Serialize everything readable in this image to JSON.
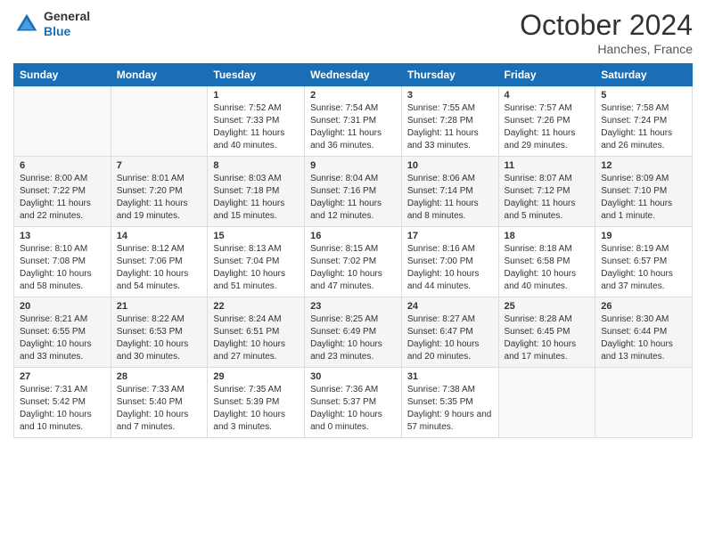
{
  "header": {
    "logo": {
      "general": "General",
      "blue": "Blue"
    },
    "title": "October 2024",
    "location": "Hanches, France"
  },
  "calendar": {
    "weekdays": [
      "Sunday",
      "Monday",
      "Tuesday",
      "Wednesday",
      "Thursday",
      "Friday",
      "Saturday"
    ],
    "weeks": [
      [
        {
          "day": "",
          "sunrise": "",
          "sunset": "",
          "daylight": ""
        },
        {
          "day": "",
          "sunrise": "",
          "sunset": "",
          "daylight": ""
        },
        {
          "day": "1",
          "sunrise": "Sunrise: 7:52 AM",
          "sunset": "Sunset: 7:33 PM",
          "daylight": "Daylight: 11 hours and 40 minutes."
        },
        {
          "day": "2",
          "sunrise": "Sunrise: 7:54 AM",
          "sunset": "Sunset: 7:31 PM",
          "daylight": "Daylight: 11 hours and 36 minutes."
        },
        {
          "day": "3",
          "sunrise": "Sunrise: 7:55 AM",
          "sunset": "Sunset: 7:28 PM",
          "daylight": "Daylight: 11 hours and 33 minutes."
        },
        {
          "day": "4",
          "sunrise": "Sunrise: 7:57 AM",
          "sunset": "Sunset: 7:26 PM",
          "daylight": "Daylight: 11 hours and 29 minutes."
        },
        {
          "day": "5",
          "sunrise": "Sunrise: 7:58 AM",
          "sunset": "Sunset: 7:24 PM",
          "daylight": "Daylight: 11 hours and 26 minutes."
        }
      ],
      [
        {
          "day": "6",
          "sunrise": "Sunrise: 8:00 AM",
          "sunset": "Sunset: 7:22 PM",
          "daylight": "Daylight: 11 hours and 22 minutes."
        },
        {
          "day": "7",
          "sunrise": "Sunrise: 8:01 AM",
          "sunset": "Sunset: 7:20 PM",
          "daylight": "Daylight: 11 hours and 19 minutes."
        },
        {
          "day": "8",
          "sunrise": "Sunrise: 8:03 AM",
          "sunset": "Sunset: 7:18 PM",
          "daylight": "Daylight: 11 hours and 15 minutes."
        },
        {
          "day": "9",
          "sunrise": "Sunrise: 8:04 AM",
          "sunset": "Sunset: 7:16 PM",
          "daylight": "Daylight: 11 hours and 12 minutes."
        },
        {
          "day": "10",
          "sunrise": "Sunrise: 8:06 AM",
          "sunset": "Sunset: 7:14 PM",
          "daylight": "Daylight: 11 hours and 8 minutes."
        },
        {
          "day": "11",
          "sunrise": "Sunrise: 8:07 AM",
          "sunset": "Sunset: 7:12 PM",
          "daylight": "Daylight: 11 hours and 5 minutes."
        },
        {
          "day": "12",
          "sunrise": "Sunrise: 8:09 AM",
          "sunset": "Sunset: 7:10 PM",
          "daylight": "Daylight: 11 hours and 1 minute."
        }
      ],
      [
        {
          "day": "13",
          "sunrise": "Sunrise: 8:10 AM",
          "sunset": "Sunset: 7:08 PM",
          "daylight": "Daylight: 10 hours and 58 minutes."
        },
        {
          "day": "14",
          "sunrise": "Sunrise: 8:12 AM",
          "sunset": "Sunset: 7:06 PM",
          "daylight": "Daylight: 10 hours and 54 minutes."
        },
        {
          "day": "15",
          "sunrise": "Sunrise: 8:13 AM",
          "sunset": "Sunset: 7:04 PM",
          "daylight": "Daylight: 10 hours and 51 minutes."
        },
        {
          "day": "16",
          "sunrise": "Sunrise: 8:15 AM",
          "sunset": "Sunset: 7:02 PM",
          "daylight": "Daylight: 10 hours and 47 minutes."
        },
        {
          "day": "17",
          "sunrise": "Sunrise: 8:16 AM",
          "sunset": "Sunset: 7:00 PM",
          "daylight": "Daylight: 10 hours and 44 minutes."
        },
        {
          "day": "18",
          "sunrise": "Sunrise: 8:18 AM",
          "sunset": "Sunset: 6:58 PM",
          "daylight": "Daylight: 10 hours and 40 minutes."
        },
        {
          "day": "19",
          "sunrise": "Sunrise: 8:19 AM",
          "sunset": "Sunset: 6:57 PM",
          "daylight": "Daylight: 10 hours and 37 minutes."
        }
      ],
      [
        {
          "day": "20",
          "sunrise": "Sunrise: 8:21 AM",
          "sunset": "Sunset: 6:55 PM",
          "daylight": "Daylight: 10 hours and 33 minutes."
        },
        {
          "day": "21",
          "sunrise": "Sunrise: 8:22 AM",
          "sunset": "Sunset: 6:53 PM",
          "daylight": "Daylight: 10 hours and 30 minutes."
        },
        {
          "day": "22",
          "sunrise": "Sunrise: 8:24 AM",
          "sunset": "Sunset: 6:51 PM",
          "daylight": "Daylight: 10 hours and 27 minutes."
        },
        {
          "day": "23",
          "sunrise": "Sunrise: 8:25 AM",
          "sunset": "Sunset: 6:49 PM",
          "daylight": "Daylight: 10 hours and 23 minutes."
        },
        {
          "day": "24",
          "sunrise": "Sunrise: 8:27 AM",
          "sunset": "Sunset: 6:47 PM",
          "daylight": "Daylight: 10 hours and 20 minutes."
        },
        {
          "day": "25",
          "sunrise": "Sunrise: 8:28 AM",
          "sunset": "Sunset: 6:45 PM",
          "daylight": "Daylight: 10 hours and 17 minutes."
        },
        {
          "day": "26",
          "sunrise": "Sunrise: 8:30 AM",
          "sunset": "Sunset: 6:44 PM",
          "daylight": "Daylight: 10 hours and 13 minutes."
        }
      ],
      [
        {
          "day": "27",
          "sunrise": "Sunrise: 7:31 AM",
          "sunset": "Sunset: 5:42 PM",
          "daylight": "Daylight: 10 hours and 10 minutes."
        },
        {
          "day": "28",
          "sunrise": "Sunrise: 7:33 AM",
          "sunset": "Sunset: 5:40 PM",
          "daylight": "Daylight: 10 hours and 7 minutes."
        },
        {
          "day": "29",
          "sunrise": "Sunrise: 7:35 AM",
          "sunset": "Sunset: 5:39 PM",
          "daylight": "Daylight: 10 hours and 3 minutes."
        },
        {
          "day": "30",
          "sunrise": "Sunrise: 7:36 AM",
          "sunset": "Sunset: 5:37 PM",
          "daylight": "Daylight: 10 hours and 0 minutes."
        },
        {
          "day": "31",
          "sunrise": "Sunrise: 7:38 AM",
          "sunset": "Sunset: 5:35 PM",
          "daylight": "Daylight: 9 hours and 57 minutes."
        },
        {
          "day": "",
          "sunrise": "",
          "sunset": "",
          "daylight": ""
        },
        {
          "day": "",
          "sunrise": "",
          "sunset": "",
          "daylight": ""
        }
      ]
    ]
  }
}
